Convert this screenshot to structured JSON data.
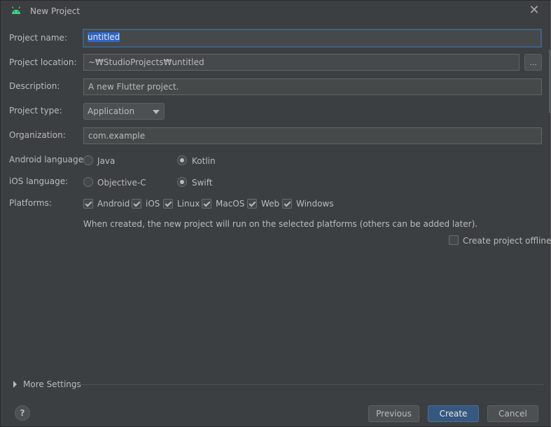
{
  "window": {
    "title": "New Project",
    "icon": "android-icon",
    "close_icon": "close-icon"
  },
  "form": {
    "project_name": {
      "label": "Project name:",
      "value": "untitled"
    },
    "project_location": {
      "label": "Project location:",
      "value": "~₩StudioProjects₩untitled",
      "browse_label": "..."
    },
    "description": {
      "label": "Description:",
      "value": "A new Flutter project."
    },
    "project_type": {
      "label": "Project type:",
      "value": "Application"
    },
    "organization": {
      "label": "Organization:",
      "value": "com.example"
    },
    "android_language": {
      "label": "Android language:",
      "options": [
        "Java",
        "Kotlin"
      ],
      "selected": "Kotlin"
    },
    "ios_language": {
      "label": "iOS language:",
      "options": [
        "Objective-C",
        "Swift"
      ],
      "selected": "Swift"
    },
    "platforms": {
      "label": "Platforms:",
      "items": [
        {
          "label": "Android",
          "checked": true
        },
        {
          "label": "iOS",
          "checked": true
        },
        {
          "label": "Linux",
          "checked": true
        },
        {
          "label": "MacOS",
          "checked": true
        },
        {
          "label": "Web",
          "checked": true
        },
        {
          "label": "Windows",
          "checked": true
        }
      ],
      "note": "When created, the new project will run on the selected platforms (others can be added later)."
    },
    "offline": {
      "label": "Create project offline",
      "checked": false
    }
  },
  "more_settings": {
    "label": "More Settings"
  },
  "footer": {
    "help_label": "?",
    "previous_label": "Previous",
    "create_label": "Create",
    "cancel_label": "Cancel"
  },
  "colors": {
    "background": "#3c3f41",
    "field": "#45494a",
    "selection": "#2f65ca",
    "primary_button": "#365880",
    "android_green": "#3ddc84"
  }
}
